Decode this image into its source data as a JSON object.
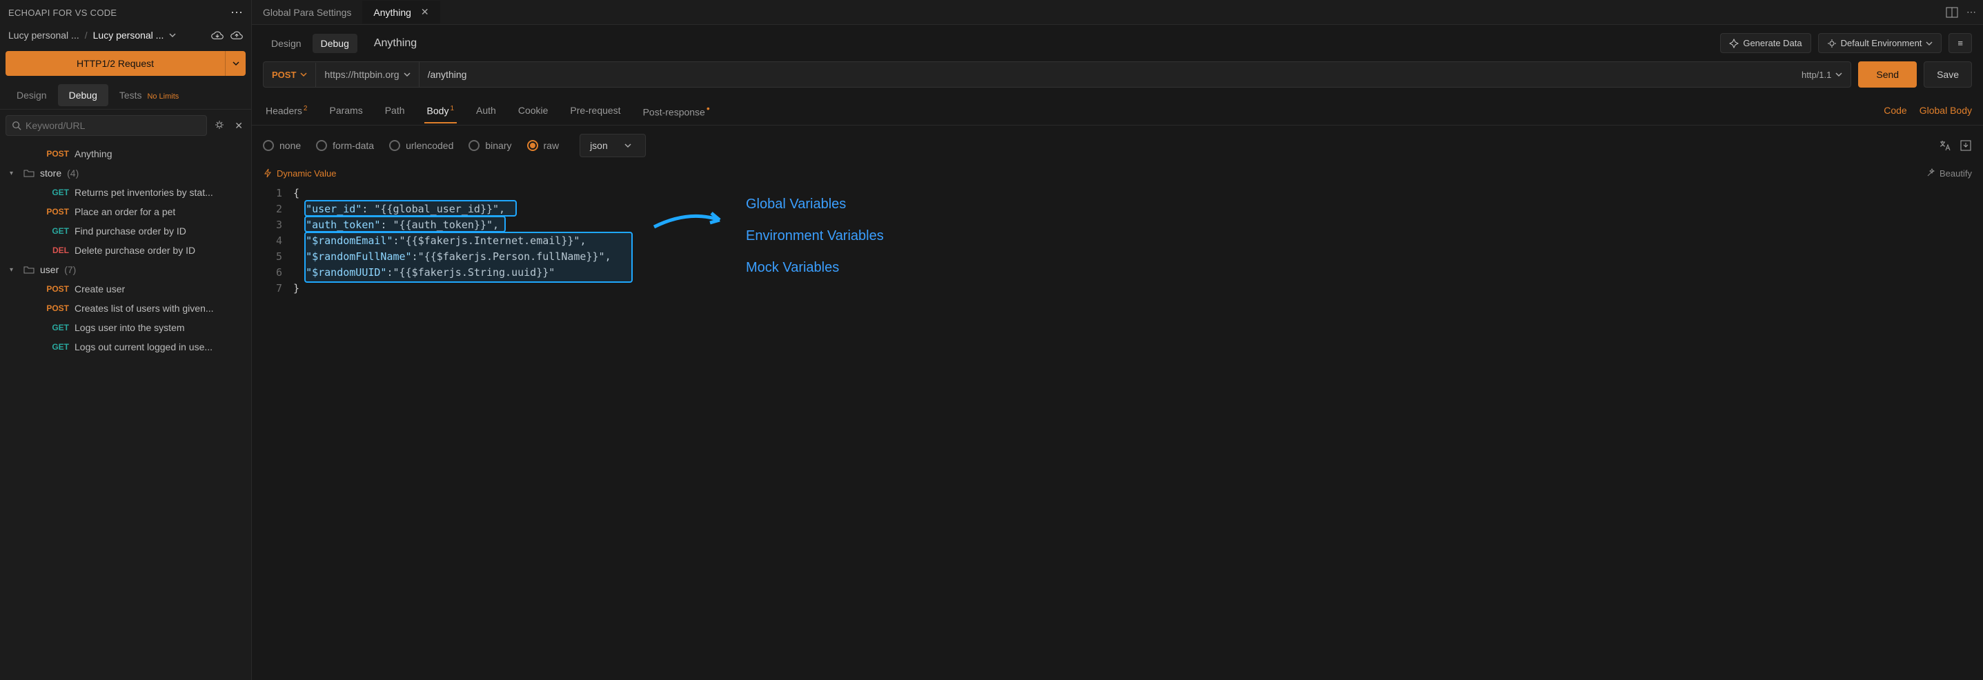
{
  "sidebar": {
    "title": "ECHOAPI FOR VS CODE",
    "breadcrumb": {
      "a": "Lucy personal ...",
      "b": "Lucy personal ..."
    },
    "new_request_btn": "HTTP1/2 Request",
    "tabs": {
      "design": "Design",
      "debug": "Debug",
      "tests": "Tests",
      "tests_badge": "No Limits"
    },
    "search_placeholder": "Keyword/URL",
    "endpoints_top": [
      {
        "method": "POST",
        "name": "Anything"
      }
    ],
    "folders": [
      {
        "name": "store",
        "count": "(4)",
        "items": [
          {
            "method": "GET",
            "name": "Returns pet inventories by stat..."
          },
          {
            "method": "POST",
            "name": "Place an order for a pet"
          },
          {
            "method": "GET",
            "name": "Find purchase order by ID"
          },
          {
            "method": "DEL",
            "name": "Delete purchase order by ID"
          }
        ]
      },
      {
        "name": "user",
        "count": "(7)",
        "items": [
          {
            "method": "POST",
            "name": "Create user"
          },
          {
            "method": "POST",
            "name": "Creates list of users with given..."
          },
          {
            "method": "GET",
            "name": "Logs user into the system"
          },
          {
            "method": "GET",
            "name": "Logs out current logged in use..."
          }
        ]
      }
    ]
  },
  "editor_tabs": [
    {
      "label": "Global Para Settings",
      "active": false
    },
    {
      "label": "Anything",
      "active": true
    }
  ],
  "request": {
    "title_tabs": {
      "design": "Design",
      "debug": "Debug"
    },
    "title": "Anything",
    "generate_data": "Generate Data",
    "environment": "Default Environment",
    "method": "POST",
    "host": "https://httpbin.org",
    "path": "/anything",
    "protocol": "http/1.1",
    "send": "Send",
    "save": "Save",
    "tabs": {
      "headers": "Headers",
      "headers_count": "2",
      "params": "Params",
      "path": "Path",
      "body": "Body",
      "body_count": "1",
      "auth": "Auth",
      "cookie": "Cookie",
      "prerequest": "Pre-request",
      "postresponse": "Post-response"
    },
    "tabs_right": {
      "code": "Code",
      "global_body": "Global Body"
    },
    "body_types": {
      "none": "none",
      "formdata": "form-data",
      "urlencoded": "urlencoded",
      "binary": "binary",
      "raw": "raw"
    },
    "body_format": "json",
    "dynamic_value": "Dynamic Value",
    "beautify": "Beautify",
    "code_lines": [
      "{",
      "  \"user_id\": \"{{global_user_id}}\",",
      "  \"auth_token\": \"{{auth_token}}\",",
      "  \"$randomEmail\":\"{{$fakerjs.Internet.email}}\",",
      "  \"$randomFullName\":\"{{$fakerjs.Person.fullName}}\",",
      "  \"$randomUUID\":\"{{$fakerjs.String.uuid}}\"",
      "}"
    ]
  },
  "annotations": {
    "global": "Global Variables",
    "environment": "Environment Variables",
    "mock": "Mock Variables"
  }
}
